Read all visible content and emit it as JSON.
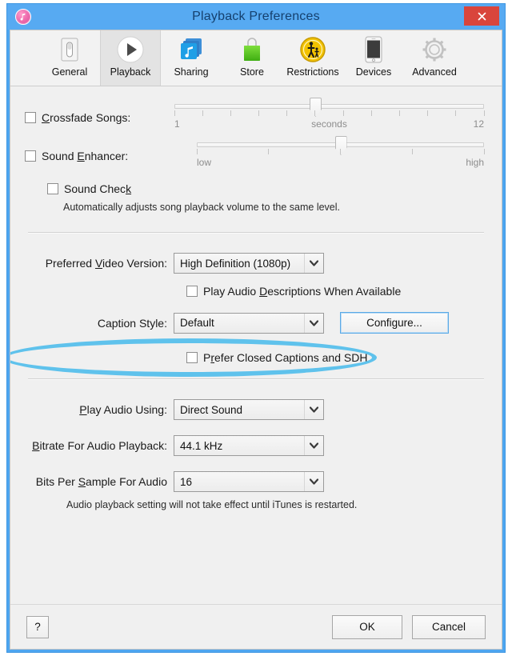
{
  "window": {
    "title": "Playback Preferences",
    "app_icon": "itunes-music-note-icon",
    "close_label": "✕",
    "colors": {
      "titlebar": "#57aaf2",
      "title_text": "#15406e",
      "close_button": "#d9453c",
      "highlight_ring": "#5fc2ec",
      "client_background": "#f0f0f0"
    }
  },
  "toolbar": {
    "tabs": [
      {
        "label": "General",
        "icon": "switch-icon",
        "selected": false
      },
      {
        "label": "Playback",
        "icon": "play-circle-icon",
        "selected": true
      },
      {
        "label": "Sharing",
        "icon": "sharing-icon",
        "selected": false
      },
      {
        "label": "Store",
        "icon": "shopping-bag-icon",
        "selected": false
      },
      {
        "label": "Restrictions",
        "icon": "parental-icon",
        "selected": false
      },
      {
        "label": "Devices",
        "icon": "iphone-icon",
        "selected": false
      },
      {
        "label": "Advanced",
        "icon": "gear-icon",
        "selected": false
      }
    ]
  },
  "playback": {
    "crossfade": {
      "label": "Crossfade Songs:",
      "accel": "C",
      "checked": false,
      "min_label": "1",
      "unit_label": "seconds",
      "max_label": "12",
      "ticks": 12,
      "value": 6
    },
    "sound_enhancer": {
      "label": "Sound Enhancer:",
      "accel": "E",
      "checked": false,
      "min_label": "low",
      "max_label": "high",
      "ticks": 5,
      "value": 3
    },
    "sound_check": {
      "label": "Sound Check",
      "accel": "k",
      "checked": false,
      "description": "Automatically adjusts song playback volume to the same level."
    }
  },
  "video": {
    "preferred_version": {
      "label": "Preferred Video Version:",
      "accel": "V",
      "value": "High Definition (1080p)"
    },
    "audio_descriptions": {
      "label": "Play Audio Descriptions When Available",
      "accel": "D",
      "checked": false
    },
    "caption_style": {
      "label": "Caption Style:",
      "value": "Default"
    },
    "configure_button": "Configure...",
    "prefer_closed_captions": {
      "label": "Prefer Closed Captions and SDH",
      "accel": "r",
      "checked": false,
      "highlighted": true
    }
  },
  "audio": {
    "play_audio_using": {
      "label": "Play Audio Using:",
      "accel": "P",
      "value": "Direct Sound"
    },
    "bitrate": {
      "label": "Bitrate For Audio Playback:",
      "accel": "B",
      "value": "44.1 kHz"
    },
    "bits_per_sample": {
      "label": "Bits Per Sample For Audio",
      "accel": "S",
      "value": "16"
    },
    "restart_note": "Audio playback setting will not take effect until iTunes is restarted."
  },
  "footer": {
    "help_label": "?",
    "ok_label": "OK",
    "cancel_label": "Cancel"
  }
}
